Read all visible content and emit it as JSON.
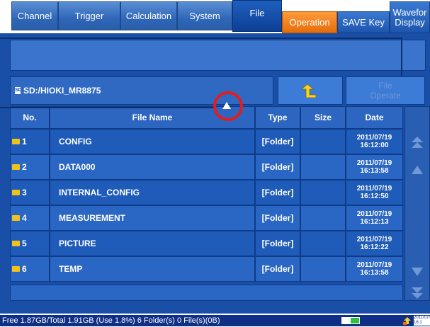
{
  "tabs": [
    {
      "label": "Channel"
    },
    {
      "label": "Trigger"
    },
    {
      "label": "Calculation"
    },
    {
      "label": "System"
    },
    {
      "label": "File"
    }
  ],
  "subtabs": {
    "operation": "Operation",
    "save_key": "SAVE Key",
    "waveform_line1": "Wavefor",
    "waveform_line2": "Display"
  },
  "path": "SD:/HIOKI_MR8875",
  "sd_badge": "SD",
  "file_operate": {
    "line1": "File",
    "line2": "Operate"
  },
  "columns": {
    "no": "No.",
    "file_name": "File Name",
    "type": "Type",
    "size": "Size",
    "date": "Date"
  },
  "rows": [
    {
      "no": "1",
      "name": "CONFIG",
      "type": "[Folder]",
      "size": "",
      "date": "2011/07/19",
      "time": "16:12:00"
    },
    {
      "no": "2",
      "name": "DATA000",
      "type": "[Folder]",
      "size": "",
      "date": "2011/07/19",
      "time": "16:13:58"
    },
    {
      "no": "3",
      "name": "INTERNAL_CONFIG",
      "type": "[Folder]",
      "size": "",
      "date": "2011/07/19",
      "time": "16:12:50"
    },
    {
      "no": "4",
      "name": "MEASUREMENT",
      "type": "[Folder]",
      "size": "",
      "date": "2011/07/19",
      "time": "16:12:13"
    },
    {
      "no": "5",
      "name": "PICTURE",
      "type": "[Folder]",
      "size": "",
      "date": "2011/07/19",
      "time": "16:12:22"
    },
    {
      "no": "6",
      "name": "TEMP",
      "type": "[Folder]",
      "size": "",
      "date": "2011/07/19",
      "time": "16:13:58"
    }
  ],
  "status": {
    "text": "Free 1.87GB/Total 1.91GB (Use 1.8%)  6 Folder(s) 0 File(s)(0B)",
    "clock": "2011/07/",
    "clock2": "16:1"
  },
  "colors": {
    "accent": "#1a4fa8",
    "orange": "#f07c1c",
    "highlight": "#e01e1e"
  }
}
